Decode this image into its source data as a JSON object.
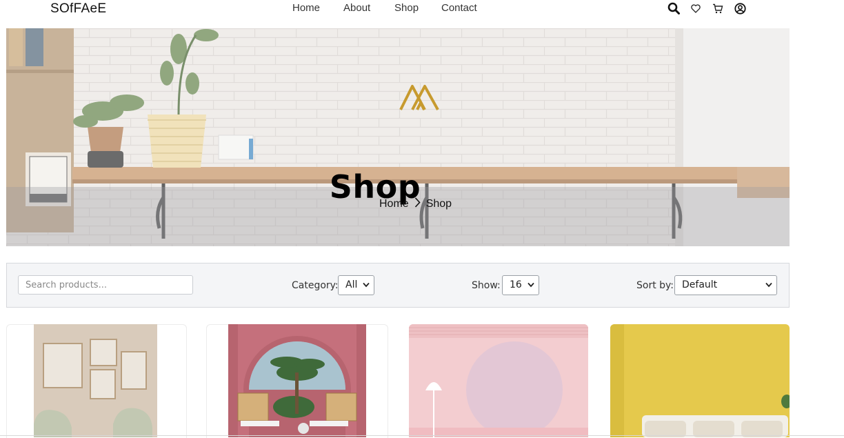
{
  "nav": {
    "brand": "SOfFAeE",
    "links": [
      "Home",
      "About",
      "Shop",
      "Contact"
    ],
    "icons": [
      "search-icon",
      "heart-icon",
      "cart-icon",
      "user-icon"
    ]
  },
  "hero": {
    "title": "Shop",
    "breadcrumb": {
      "home": "Home",
      "current": "Shop"
    }
  },
  "filters": {
    "search_placeholder": "Search products...",
    "category_label": "Category:",
    "category_value": "All",
    "show_label": "Show:",
    "show_value": "16",
    "sort_label": "Sort by:",
    "sort_value": "Default"
  },
  "products": [
    {
      "image": "frames-and-chairs"
    },
    {
      "image": "pink-arch-chairs"
    },
    {
      "image": "pink-room-lamp"
    },
    {
      "image": "yellow-wall-sofa"
    }
  ],
  "colors": {
    "accent_gold": "#c79a2e",
    "filter_bg": "#f4f5f7"
  }
}
